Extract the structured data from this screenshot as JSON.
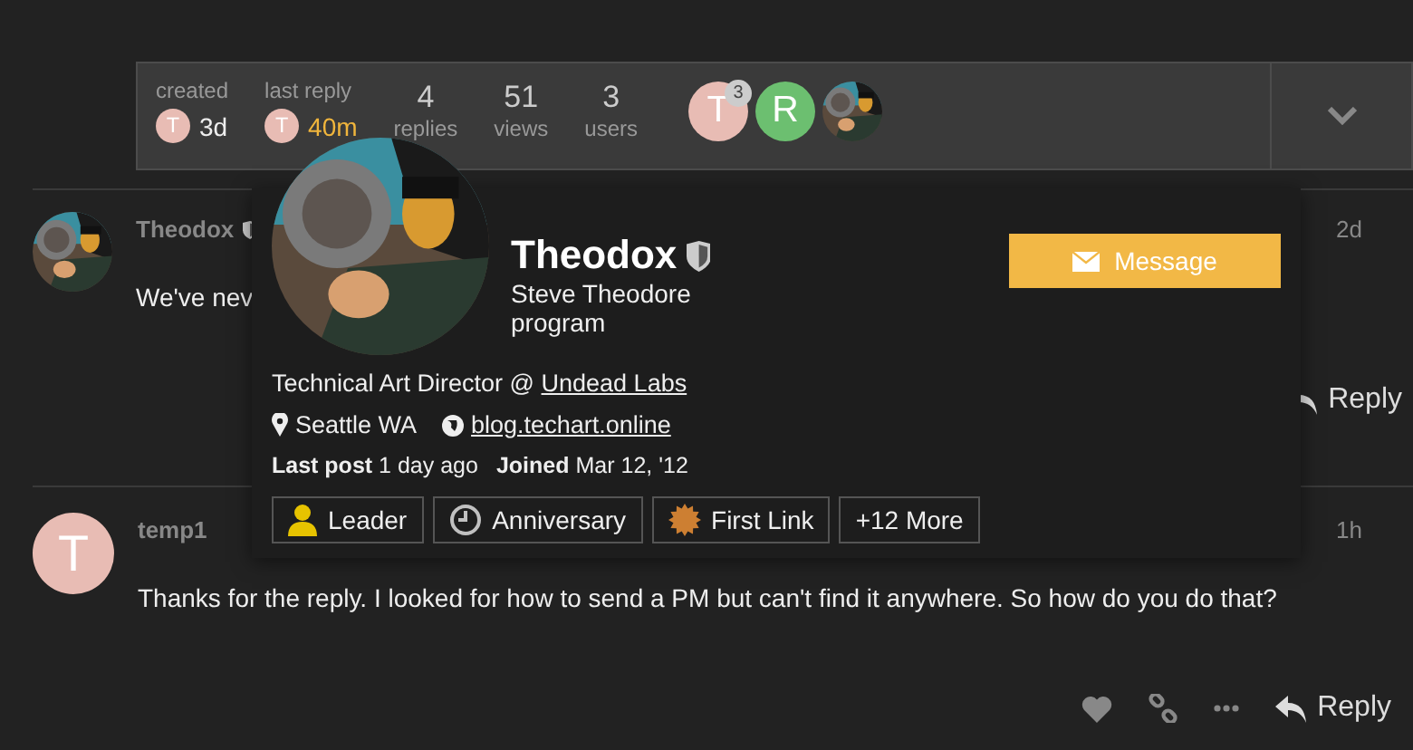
{
  "topic_map": {
    "created": {
      "label": "created",
      "avatar_letter": "T",
      "value": "3d"
    },
    "last_reply": {
      "label": "last reply",
      "avatar_letter": "T",
      "value": "40m"
    },
    "stats": [
      {
        "value": "4",
        "label": "replies"
      },
      {
        "value": "51",
        "label": "views"
      },
      {
        "value": "3",
        "label": "users"
      }
    ],
    "participants": [
      {
        "kind": "letter",
        "letter": "T",
        "color": "#e8bcb4",
        "count": "3"
      },
      {
        "kind": "letter",
        "letter": "R",
        "color": "#6cbf70"
      },
      {
        "kind": "picture"
      }
    ]
  },
  "posts": [
    {
      "username": "Theodox",
      "moderator": true,
      "time": "2d",
      "avatar": {
        "kind": "picture"
      },
      "body": "We've nev",
      "reply_label": "Reply"
    },
    {
      "username": "temp1",
      "moderator": false,
      "time": "1h",
      "avatar": {
        "kind": "letter",
        "letter": "T",
        "color": "#e8bcb4"
      },
      "body": "Thanks for the reply. I looked for how to send a PM but can't find it anywhere. So how do you do that?",
      "icons": [
        {
          "kind": "like"
        },
        {
          "kind": "link"
        },
        {
          "kind": "more"
        }
      ],
      "reply_label": "Reply"
    }
  ],
  "user_card": {
    "name": "Theodox",
    "moderator": true,
    "full_name": "Steve Theodore",
    "title": "program",
    "message_button": "Message",
    "bio": {
      "text": "Technical Art Director @ ",
      "link": "Undead Labs"
    },
    "location": "Seattle WA",
    "website": "blog.techart.online",
    "last_post": {
      "label": "Last post",
      "value": "1 day ago"
    },
    "joined": {
      "label": "Joined",
      "value": "Mar 12, '12"
    },
    "badges": [
      {
        "kind": "user",
        "label": "Leader",
        "color": "#e7c300"
      },
      {
        "kind": "clock",
        "label": "Anniversary",
        "color": "#c0c0c0"
      },
      {
        "kind": "sun",
        "label": "First Link",
        "color": "#cd7f32"
      },
      {
        "kind": "more",
        "label": "+12 More"
      }
    ]
  }
}
